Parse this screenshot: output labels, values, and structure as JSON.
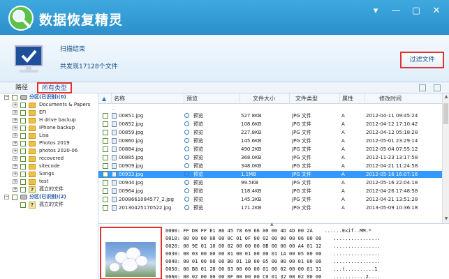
{
  "app": {
    "title": "数据恢复精灵",
    "colors": {
      "titlebar": "#2b8fcb",
      "accent": "#1c56a6",
      "highlight": "#e03030",
      "selected": "#3399ff"
    },
    "window_controls": [
      "▾",
      "—",
      "▢",
      "✕"
    ]
  },
  "status": {
    "scan_title": "扫描结束",
    "found_text": "共发现17128个文件",
    "filter_button": "过滤文件"
  },
  "tabs": {
    "path": "路径",
    "all_types": "所有类型"
  },
  "tree": {
    "partition1": "分区(已识别)(0)",
    "items": [
      "Documents & Papers",
      "EFI",
      "H drive backup",
      "iPhone backup",
      "Lisa",
      "Photos 2019",
      "photos 2020-06",
      "recovered",
      "sitecode",
      "Songs",
      "test",
      "孤立的文件"
    ],
    "partition2": "分区(已识别)(2)",
    "orphan2": "孤立的文件"
  },
  "table": {
    "columns": {
      "name": "名称",
      "preview": "预览",
      "size": "文件大小",
      "type": "文件类型",
      "attr": "属性",
      "modified": "修改时间"
    },
    "parent_row": "..",
    "rows": [
      {
        "name": "00851.jpg",
        "preview": "预览",
        "size": "527.8KB",
        "type": "JPG 文件",
        "attr": "A",
        "modified": "2012-04-11 09:45:24"
      },
      {
        "name": "00852.jpg",
        "preview": "预览",
        "size": "108.6KB",
        "type": "JPG 文件",
        "attr": "A",
        "modified": "2012-04-12 17:10:42"
      },
      {
        "name": "00859.jpg",
        "preview": "预览",
        "size": "227.8KB",
        "type": "JPG 文件",
        "attr": "A",
        "modified": "2012-04-12 05:18:28"
      },
      {
        "name": "00860.jpg",
        "preview": "预览",
        "size": "145.6KB",
        "type": "JPG 文件",
        "attr": "A",
        "modified": "2012-05-01 23:29:14"
      },
      {
        "name": "00884.jpg",
        "preview": "预览",
        "size": "490.2KB",
        "type": "JPG 文件",
        "attr": "A",
        "modified": "2012-05-04 07:55:12"
      },
      {
        "name": "00885.jpg",
        "preview": "预览",
        "size": "368.0KB",
        "type": "JPG 文件",
        "attr": "A",
        "modified": "2012-11-23 13:17:58"
      },
      {
        "name": "00909.jpg",
        "preview": "预览",
        "size": "348.0KB",
        "type": "JPG 文件",
        "attr": "A",
        "modified": "2012-04-21 11:24:58"
      },
      {
        "name": "00933.jpg",
        "preview": "预览",
        "size": "1.1MB",
        "type": "JPG 文件",
        "attr": "A",
        "modified": "2012-05-16 16:07:16"
      },
      {
        "name": "00944.jpg",
        "preview": "预览",
        "size": "99.5KB",
        "type": "JPG 文件",
        "attr": "A",
        "modified": "2012-05-16 22:04:18"
      },
      {
        "name": "00964.jpg",
        "preview": "预览",
        "size": "118.4KB",
        "type": "JPG 文件",
        "attr": "A",
        "modified": "2012-04-26 17:48:58"
      },
      {
        "name": "2008661084577_2.jpg",
        "preview": "预览",
        "size": "145.3KB",
        "type": "JPG 文件",
        "attr": "A",
        "modified": "2012-04-21 13:51:28"
      },
      {
        "name": "20130425170522.jpg",
        "preview": "预览",
        "size": "171.2KB",
        "type": "JPG 文件",
        "attr": "A",
        "modified": "2013-05-09 10:36:18"
      }
    ],
    "selected_index": 7
  },
  "hex": {
    "lines": [
      "0000: FF D8 FF E1 86 45 78 69 66 00 00 4D 4D 00 2A    ......Exif..MM.*",
      "0010: 00 00 00 08 00 0C 01 0F 00 02 00 00 00 06 00 00    ................",
      "0020: 00 9E 01 10 00 02 00 00 00 0B 00 00 00 A4 01 12    ................",
      "0030: 00 03 00 00 00 01 00 01 00 00 01 1A 00 05 00 00    ................",
      "0040: 00 01 00 00 00 B0 01 1B 00 05 00 00 00 01 00 00    ................",
      "0050: 00 B8 01 28 00 03 00 00 00 01 00 02 00 00 01 31    ...(..........1",
      "0060: 00 02 00 00 00 0F 00 00 00 C0 01 32 00 02 00 00    ...........2...."
    ]
  }
}
